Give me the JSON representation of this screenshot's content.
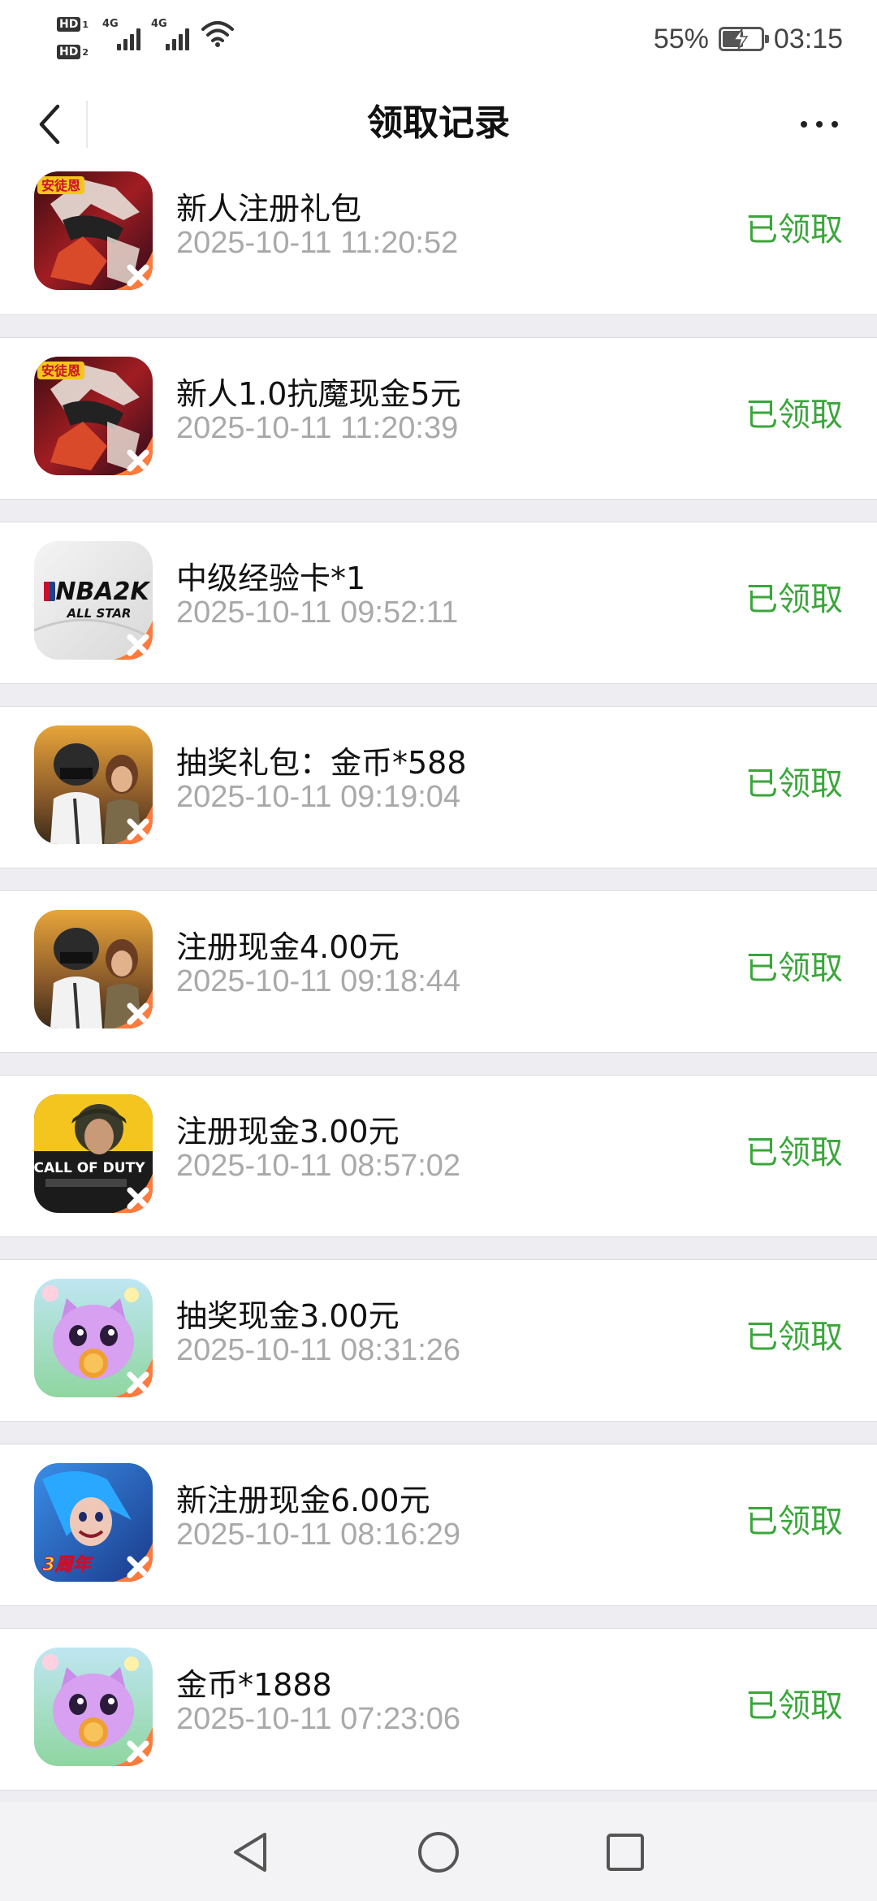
{
  "status_bar": {
    "sim1_label": "HD",
    "sim1_index": "1",
    "sim2_label": "HD",
    "sim2_index": "2",
    "network1": "4G",
    "network2": "4G",
    "battery_percent": "55%",
    "battery_level": 0.55,
    "time": "03:15"
  },
  "header": {
    "title": "领取记录",
    "back_icon": "chevron-left-icon",
    "more_icon": "more-dots-icon"
  },
  "records": [
    {
      "title": "新人注册礼包",
      "time": "2025-10-11 11:20:52",
      "status": "已领取",
      "icon": "anime-game-icon"
    },
    {
      "title": "新人1.0抗魔现金5元",
      "time": "2025-10-11 11:20:39",
      "status": "已领取",
      "icon": "anime-game-icon"
    },
    {
      "title": "中级经验卡*1",
      "time": "2025-10-11 09:52:11",
      "status": "已领取",
      "icon": "nba2k-game-icon"
    },
    {
      "title": "抽奖礼包：金币*588",
      "time": "2025-10-11 09:19:04",
      "status": "已领取",
      "icon": "pubg-game-icon"
    },
    {
      "title": "注册现金4.00元",
      "time": "2025-10-11 09:18:44",
      "status": "已领取",
      "icon": "pubg-game-icon"
    },
    {
      "title": "注册现金3.00元",
      "time": "2025-10-11 08:57:02",
      "status": "已领取",
      "icon": "call-of-duty-game-icon"
    },
    {
      "title": "抽奖现金3.00元",
      "time": "2025-10-11 08:31:26",
      "status": "已领取",
      "icon": "cat-game-icon"
    },
    {
      "title": "新注册现金6.00元",
      "time": "2025-10-11 08:16:29",
      "status": "已领取",
      "icon": "hero-game-icon"
    },
    {
      "title": "金币*1888",
      "time": "2025-10-11 07:23:06",
      "status": "已领取",
      "icon": "cat-game-icon"
    }
  ],
  "icon_text": {
    "anime_badge": "安徒恩",
    "nba_main": "NBA2K",
    "nba_sub": "ALL STAR",
    "cod_main": "CALL OF DUTY",
    "hero_badge": "3周年"
  },
  "colors": {
    "status_green": "#3aa63a",
    "time_gray": "#a9a9a9",
    "background": "#ededf2"
  },
  "navbar": {
    "back_icon": "triangle-back-icon",
    "home_icon": "circle-home-icon",
    "recents_icon": "square-recents-icon"
  }
}
